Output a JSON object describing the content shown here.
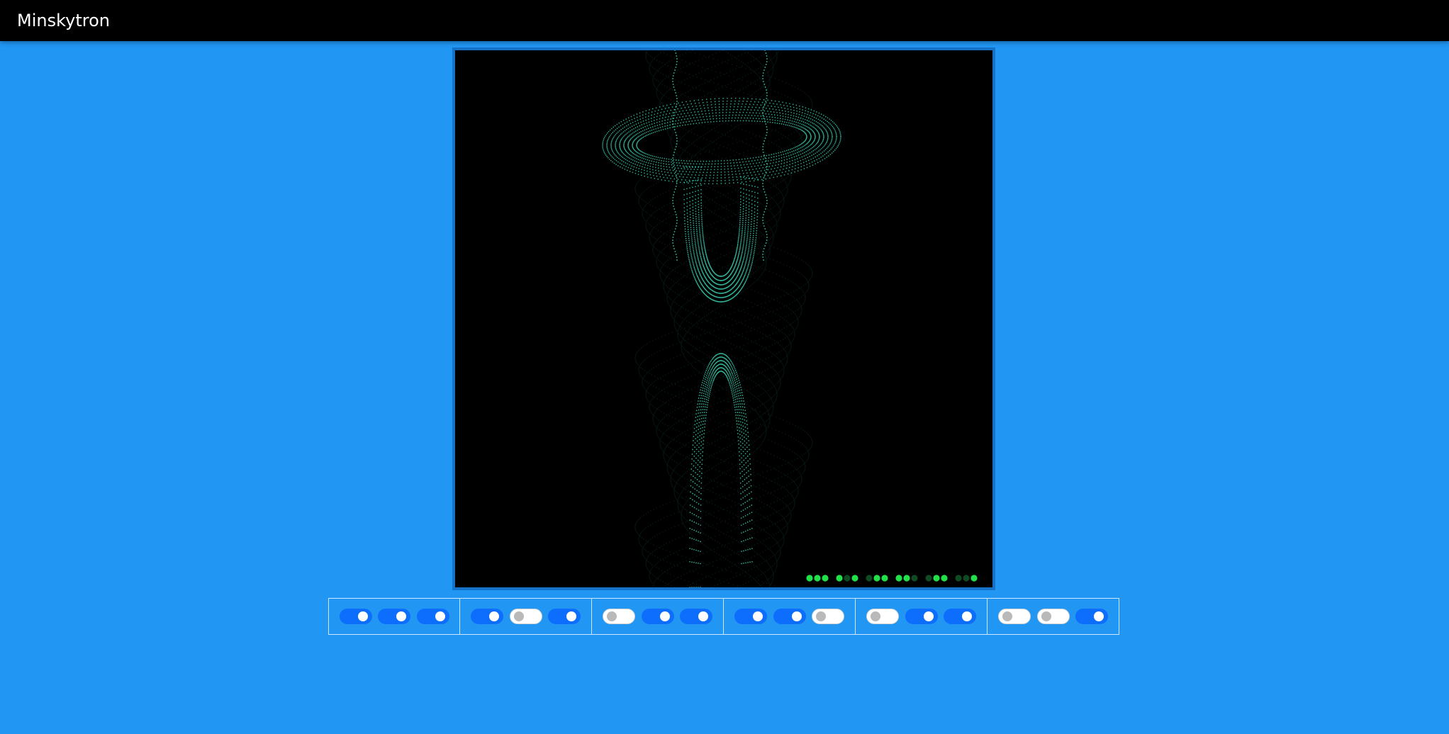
{
  "app": {
    "title": "Minskytron"
  },
  "display": {
    "background_color": "#000000",
    "trace_color": "#3fe0c0",
    "led_on_color": "#22e04a",
    "led_off_color": "#0f4a22",
    "status_lights": [
      [
        true,
        true,
        true
      ],
      [
        true,
        false,
        true
      ],
      [
        false,
        true,
        true
      ],
      [
        true,
        true,
        false
      ],
      [
        false,
        true,
        true
      ],
      [
        false,
        false,
        true
      ]
    ]
  },
  "controls": {
    "switch_on_color": "#0d6efd",
    "switch_off_color": "#ffffff",
    "groups": [
      {
        "switches": [
          true,
          true,
          true
        ]
      },
      {
        "switches": [
          true,
          false,
          true
        ]
      },
      {
        "switches": [
          false,
          true,
          true
        ]
      },
      {
        "switches": [
          true,
          true,
          false
        ]
      },
      {
        "switches": [
          false,
          true,
          true
        ]
      },
      {
        "switches": [
          false,
          false,
          true
        ]
      }
    ]
  }
}
